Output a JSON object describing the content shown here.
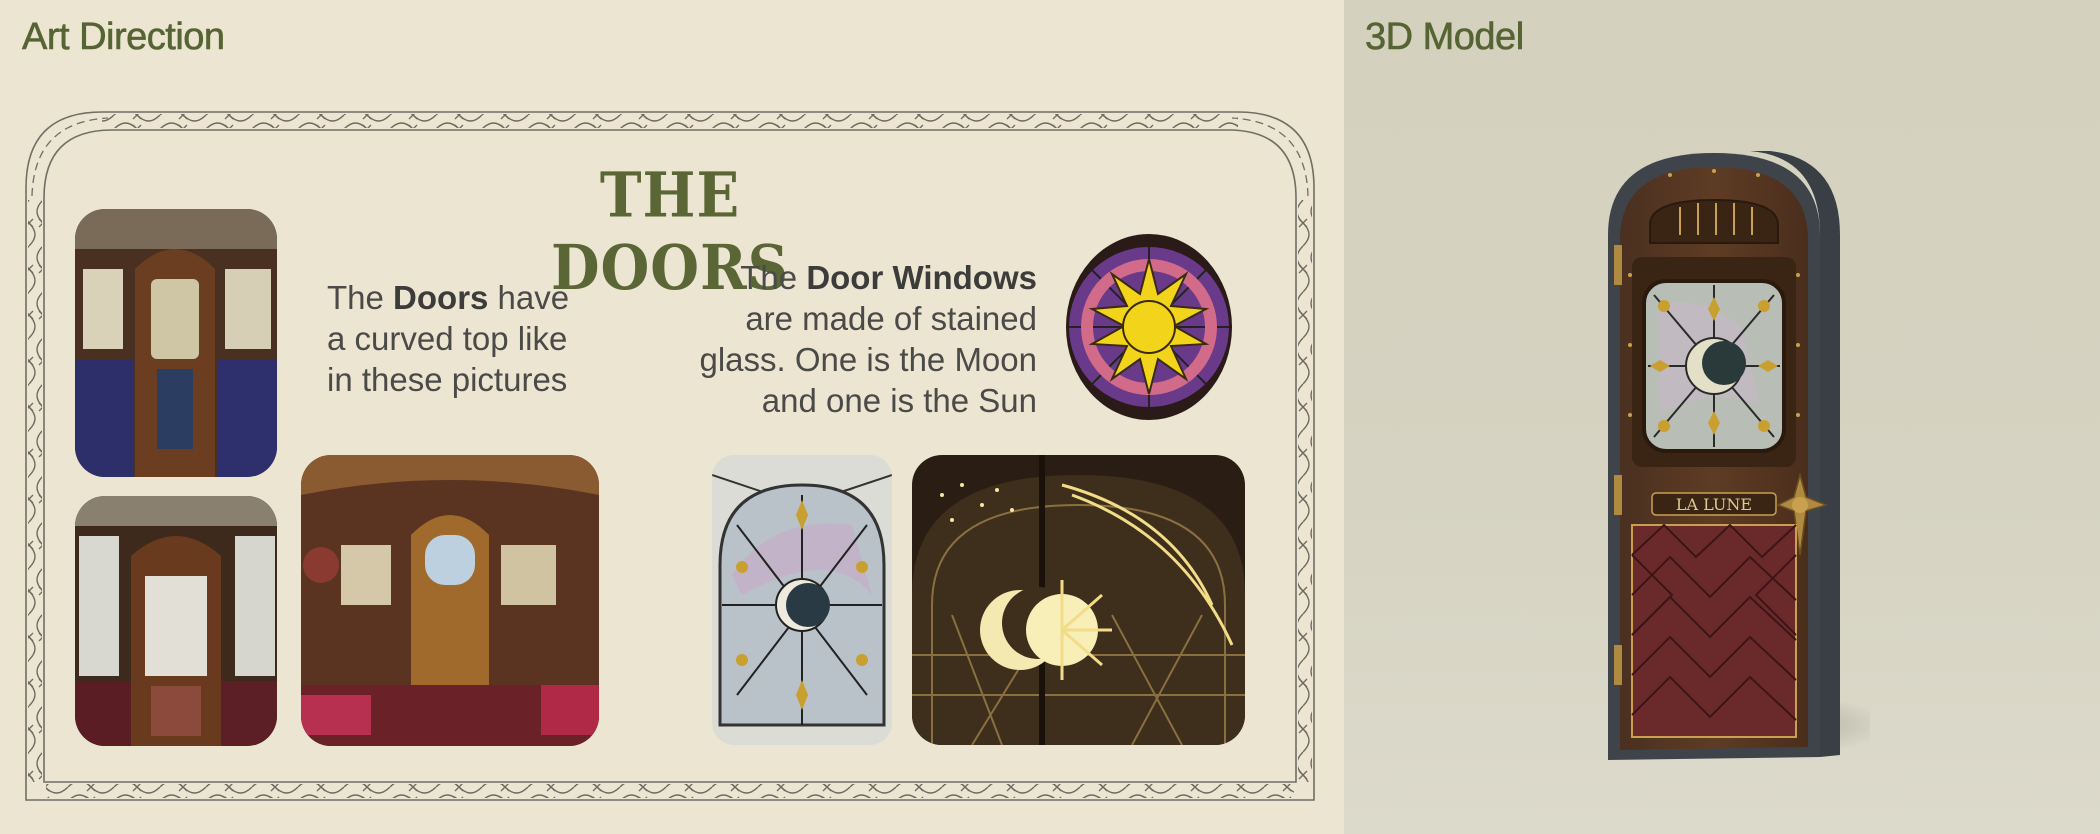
{
  "left_panel": {
    "title": "Art Direction"
  },
  "right_panel": {
    "title": "3D Model"
  },
  "board": {
    "title": "THE DOORS",
    "doors_text": {
      "pre": "The ",
      "bold": "Doors",
      "line1_post": " have",
      "line2": "a curved top like",
      "line3": "in these pictures"
    },
    "windows_text": {
      "pre": "The ",
      "bold": "Door Windows",
      "line2": "are made of stained",
      "line3": "glass. One is the Moon",
      "line4": "and one is the Sun"
    }
  },
  "model": {
    "door_plaque": "LA LUNE"
  },
  "colors": {
    "left_bg": "#ece5d1",
    "right_bg": "#d4d1be",
    "title_green": "#566434",
    "text_gray": "#4a4a48"
  }
}
